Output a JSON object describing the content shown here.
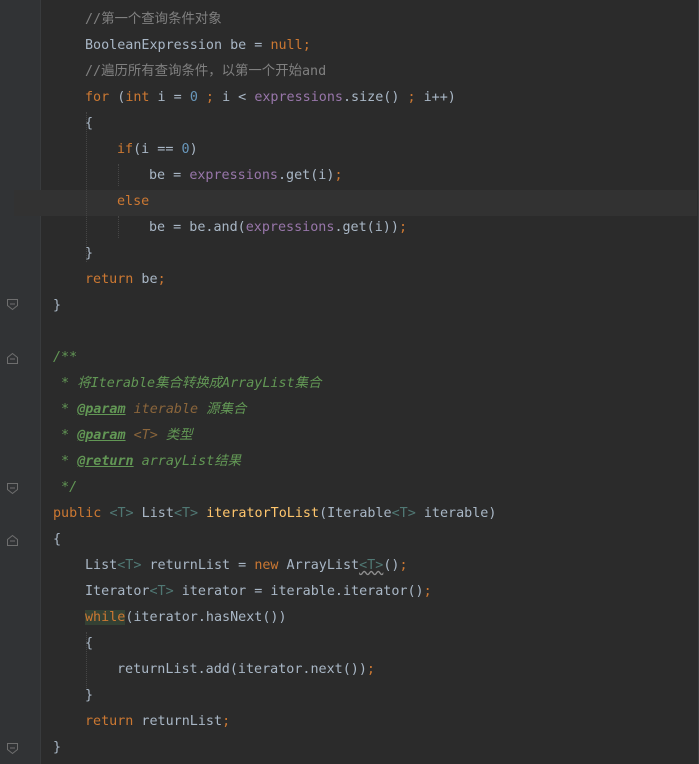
{
  "lines": {
    "l1": {
      "comment": "//第一个查询条件对象"
    },
    "l2": {
      "type": "BooleanExpression",
      "var": " be = ",
      "null_kw": "null",
      "semi": ";"
    },
    "l3": {
      "comment": "//遍历所有查询条件，以第一个开始and"
    },
    "l4": {
      "for_kw": "for",
      "open": " (",
      "int_kw": "int",
      "mid": " i = ",
      "zero": "0",
      "semi1": " ; ",
      "cond": "i < ",
      "field": "expressions",
      "call": ".size() ",
      "semi2": "; ",
      "inc": "i++)"
    },
    "l5": {
      "text": "{"
    },
    "l6": {
      "if_kw": "if",
      "cond_a": "(i == ",
      "zero": "0",
      "cond_b": ")"
    },
    "l7": {
      "lhs": "be = ",
      "field": "expressions",
      "call": ".get(i)",
      "semi": ";"
    },
    "l8": {
      "else_kw": "else"
    },
    "l9": {
      "lhs": "be = be.and(",
      "field": "expressions",
      "call": ".get(i))",
      "semi": ";"
    },
    "l10": {
      "text": "}"
    },
    "l11": {
      "return_kw": "return",
      "rest": " be",
      "semi": ";"
    },
    "l12": {
      "text": "}"
    },
    "l14": {
      "text": "/**"
    },
    "l15": {
      "text": " * 将Iterable集合转换成ArrayList集合"
    },
    "l16": {
      "star": " * ",
      "tag": "@param",
      "param": " iterable",
      "desc": " 源集合"
    },
    "l17": {
      "star": " * ",
      "tag": "@param",
      "param": " <T>",
      "desc": " 类型"
    },
    "l18": {
      "star": " * ",
      "tag": "@return",
      "desc": " arrayList结果"
    },
    "l19": {
      "text": " */"
    },
    "l20": {
      "public_kw": "public",
      "sp1": " ",
      "t1": "<T>",
      "list": " List",
      "t2": "<T>",
      "sp2": " ",
      "fn": "iteratorToList",
      "arg": "(Iterable",
      "t3": "<T>",
      "rest": " iterable)"
    },
    "l21": {
      "text": "{"
    },
    "l22": {
      "list": "List",
      "t1": "<T>",
      "mid": " returnList = ",
      "new_kw": "new",
      "cls": " ArrayList",
      "t2": "<T>",
      "end": "()",
      "semi": ";"
    },
    "l23": {
      "iter": "Iterator",
      "t1": "<T>",
      "mid": " iterator = iterable.iterator()",
      "semi": ";"
    },
    "l24": {
      "while_kw": "while",
      "rest": "(iterator.hasNext())"
    },
    "l25": {
      "text": "{"
    },
    "l26": {
      "call": "returnList.add(iterator.next())",
      "semi": ";"
    },
    "l27": {
      "text": "}"
    },
    "l28": {
      "return_kw": "return",
      "rest": " returnList",
      "semi": ";"
    },
    "l29": {
      "text": "}"
    }
  },
  "icons": {
    "fold_close": "fold-close-icon",
    "fold_open": "fold-open-icon"
  }
}
